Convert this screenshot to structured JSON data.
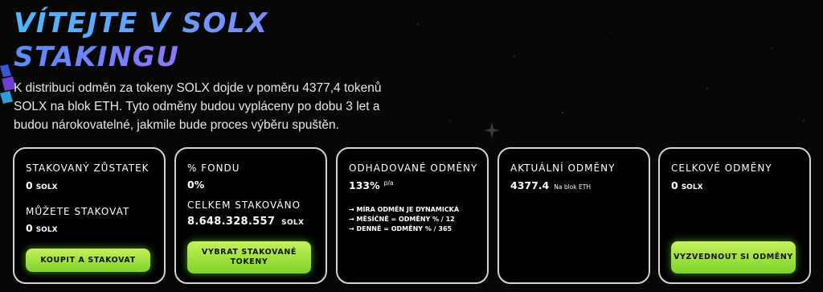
{
  "hero": {
    "title_line1": "VÍTEJTE V SOLX",
    "title_line2": "STAKINGU",
    "description": "K distribuci odměn za tokeny SOLX dojde v poměru 4377,4 tokenů SOLX na blok ETH. Tyto odměny budou vypláceny po dobu 3 let a budou nárokovatelné, jakmile bude proces výběru spuštěn."
  },
  "cards": {
    "staked_balance": {
      "label": "STAKOVANÝ ZŮSTATEK",
      "value": "0",
      "unit": "SOLX",
      "can_stake_label": "MŮŽETE STAKOVAT",
      "can_stake_value": "0",
      "can_stake_unit": "SOLX",
      "button_label": "KOUPIT A STAKOVAT"
    },
    "pool": {
      "label": "% FONDU",
      "value": "0%",
      "total_label": "CELKEM STAKOVÁNO",
      "total_value": "8.648.328.557",
      "total_unit": "SOLX",
      "button_label": "VYBRAT STAKOVANÉ TOKENY"
    },
    "estimated": {
      "label": "ODHADOVANÉ ODMĚNY",
      "value": "133%",
      "suffix": "p/a",
      "notes": [
        "→ MÍRA ODMĚN JE DYNAMICKÁ",
        "→ MĚSÍČNĚ = ODMĚNY % / 12",
        "→ DENNĚ = ODMĚNY % / 365"
      ]
    },
    "current": {
      "label": "AKTUÁLNÍ ODMĚNY",
      "value": "4377.4",
      "suffix": "Na blok ETH"
    },
    "total": {
      "label": "CELKOVÉ ODMĚNY",
      "value": "0",
      "unit": "SOLX",
      "button_label": "VYZVEDNOUT SI ODMĚNY"
    }
  },
  "colors": {
    "background": "#070708",
    "button_green": "#a6e640",
    "title_blue": "#4fb7ff",
    "title_purple": "#a76bff",
    "card_border": "#d4d4d8"
  }
}
